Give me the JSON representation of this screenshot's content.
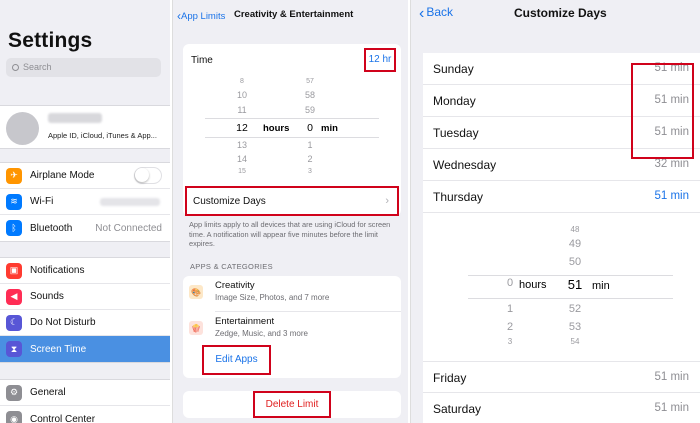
{
  "settings": {
    "title": "Settings",
    "search_placeholder": "Search",
    "profile_subtitle": "Apple ID, iCloud, iTunes & App...",
    "group1": [
      {
        "label": "Airplane Mode",
        "icon": "airplane-icon",
        "color": "#ff9500"
      },
      {
        "label": "Wi-Fi",
        "icon": "wifi-icon",
        "color": "#007aff"
      },
      {
        "label": "Bluetooth",
        "icon": "bluetooth-icon",
        "color": "#007aff",
        "value": "Not Connected"
      }
    ],
    "group2": [
      {
        "label": "Notifications",
        "icon": "notifications-icon",
        "color": "#ff3b30"
      },
      {
        "label": "Sounds",
        "icon": "sounds-icon",
        "color": "#ff2d55"
      },
      {
        "label": "Do Not Disturb",
        "icon": "moon-icon",
        "color": "#5856d6"
      },
      {
        "label": "Screen Time",
        "icon": "hourglass-icon",
        "color": "#5856d6"
      }
    ],
    "group3": [
      {
        "label": "General",
        "icon": "gear-icon",
        "color": "#8e8e93"
      },
      {
        "label": "Control Center",
        "icon": "control-center-icon",
        "color": "#8e8e93"
      }
    ],
    "selected_color": "#4a90e2"
  },
  "app_limit": {
    "back_label": "App Limits",
    "nav_title": "Creativity & Entertainment",
    "time_label": "Time",
    "time_value": "12 hr",
    "picker_hours": [
      "8",
      "10",
      "11",
      "12",
      "13",
      "14",
      "15"
    ],
    "picker_minutes": [
      "57",
      "58",
      "59",
      "0",
      "1",
      "2",
      "3"
    ],
    "hours_unit": "hours",
    "min_unit": "min",
    "customize_days_label": "Customize Days",
    "note": "App limits apply to all devices that are using iCloud for screen time. A notification will appear five minutes before the limit expires.",
    "section_header": "APPS & CATEGORIES",
    "apps": [
      {
        "name": "Creativity",
        "detail": "Image Size, Photos, and 7 more",
        "icon": "creativity-icon"
      },
      {
        "name": "Entertainment",
        "detail": "Zedge, Music, and 3 more",
        "icon": "entertainment-icon"
      }
    ],
    "edit_apps_label": "Edit Apps",
    "delete_limit_label": "Delete Limit",
    "accent": "#1a73e8",
    "highlight_border": "#d0021b"
  },
  "customize_days": {
    "back_label": "Back",
    "nav_title": "Customize Days",
    "days_top": [
      {
        "day": "Sunday",
        "value": "51 min"
      },
      {
        "day": "Monday",
        "value": "51 min"
      },
      {
        "day": "Tuesday",
        "value": "51 min"
      },
      {
        "day": "Wednesday",
        "value": "32 min"
      },
      {
        "day": "Thursday",
        "value": "51 min",
        "active": true
      }
    ],
    "picker_hours": [
      "0",
      "1",
      "2",
      "3"
    ],
    "picker_minutes": [
      "48",
      "49",
      "50",
      "51",
      "52",
      "53",
      "54"
    ],
    "hours_unit": "hours",
    "min_unit": "min",
    "days_bottom": [
      {
        "day": "Friday",
        "value": "51 min"
      },
      {
        "day": "Saturday",
        "value": "51 min"
      }
    ]
  }
}
